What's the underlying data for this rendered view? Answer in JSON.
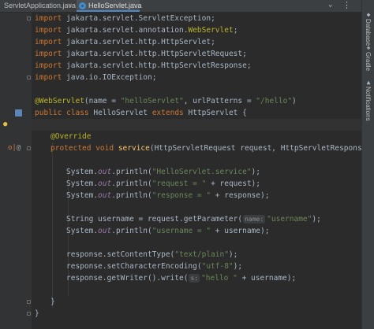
{
  "tabs": [
    {
      "label": "ServletApplication.java",
      "active": false
    },
    {
      "label": "HelloServlet.java",
      "active": true
    }
  ],
  "tab_bar": {
    "menu_glyph": "⌄",
    "more_glyph": "⋮"
  },
  "side_tools": {
    "database": "Database",
    "gradle": "Gradle",
    "notifications": "Notifications"
  },
  "gutter_glyphs": {
    "override": "o|",
    "at": "@",
    "bulb": "●"
  },
  "colors": {
    "background": "#2b2b2b",
    "keyword": "#cc7832",
    "annotation": "#bbb529",
    "string": "#6a8759",
    "static_field": "#9876aa",
    "method": "#ffc66d",
    "plain": "#a9b7c6"
  },
  "code": {
    "l1": {
      "kw": "import",
      "rest": " jakarta.servlet.ServletException;"
    },
    "l2": {
      "kw": "import",
      "pre": " jakarta.servlet.annotation.",
      "an": "WebServlet",
      "post": ";"
    },
    "l3": {
      "kw": "import",
      "rest": " jakarta.servlet.http.HttpServlet;"
    },
    "l4": {
      "kw": "import",
      "rest": " jakarta.servlet.http.HttpServletRequest;"
    },
    "l5": {
      "kw": "import",
      "rest": " jakarta.servlet.http.HttpServletResponse;"
    },
    "l6": {
      "kw": "import",
      "rest": " java.io.IOException;"
    },
    "l8": {
      "an": "@WebServlet",
      "p1": "(name = ",
      "s1": "\"helloServlet\"",
      "p2": ", urlPatterns = ",
      "s2": "\"/hello\"",
      "p3": ")"
    },
    "l9": {
      "kw1": "public class",
      "p1": " HelloServlet ",
      "kw2": "extends",
      "p2": " HttpServlet {"
    },
    "l11": {
      "an": "@Override"
    },
    "l12": {
      "kw": "protected void",
      "sp": " ",
      "mt": "service",
      "rest": "(HttpServletRequest request, HttpServletResponse respon"
    },
    "l14": {
      "p1": "System.",
      "fd": "out",
      "p2": ".println(",
      "s": "\"HelloServlet.service\"",
      "p3": ");"
    },
    "l15": {
      "p1": "System.",
      "fd": "out",
      "p2": ".println(",
      "s": "\"request = \"",
      "p3": " + request);"
    },
    "l16": {
      "p1": "System.",
      "fd": "out",
      "p2": ".println(",
      "s": "\"response = \"",
      "p3": " + response);"
    },
    "l18": {
      "p1": "String username = request.getParameter(",
      "hint": "name:",
      "s": "\"username\"",
      "p2": ");"
    },
    "l19": {
      "p1": "System.",
      "fd": "out",
      "p2": ".println(",
      "s": "\"username = \"",
      "p3": " + username);"
    },
    "l21": {
      "p1": "response.setContentType(",
      "s": "\"text/plain\"",
      "p2": ");"
    },
    "l22": {
      "p1": "response.setCharacterEncoding(",
      "s": "\"utf-8\"",
      "p2": ");"
    },
    "l23": {
      "p1": "response.getWriter().write(",
      "hint": "s:",
      "s": "\"hello \"",
      "p2": " + username);"
    },
    "l25": {
      "text": "}"
    },
    "l26": {
      "text": "}"
    }
  }
}
